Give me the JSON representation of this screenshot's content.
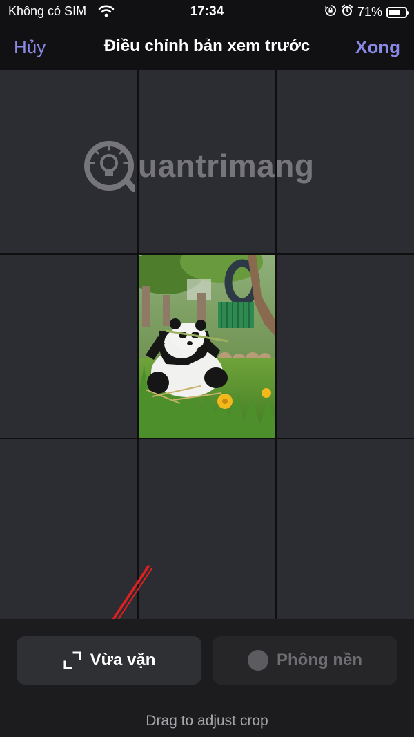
{
  "status_bar": {
    "carrier": "Không có SIM",
    "time": "17:34",
    "battery": "71%",
    "battery_level": 0.71
  },
  "nav": {
    "cancel": "Hủy",
    "title": "Điều chỉnh bản xem trước",
    "done": "Xong"
  },
  "watermark": "uantrimang",
  "controls": {
    "fit_label": "Vừa vặn",
    "background_label": "Phông nền"
  },
  "hint": "Drag to adjust crop",
  "colors": {
    "accent": "#8a8ae6",
    "canvas": "#2c2d33",
    "annotation_arrow": "#e02020"
  },
  "icons": [
    "wifi-icon",
    "orientation-lock-icon",
    "alarm-icon",
    "battery-icon",
    "fit-corners-icon",
    "background-circle-icon"
  ]
}
